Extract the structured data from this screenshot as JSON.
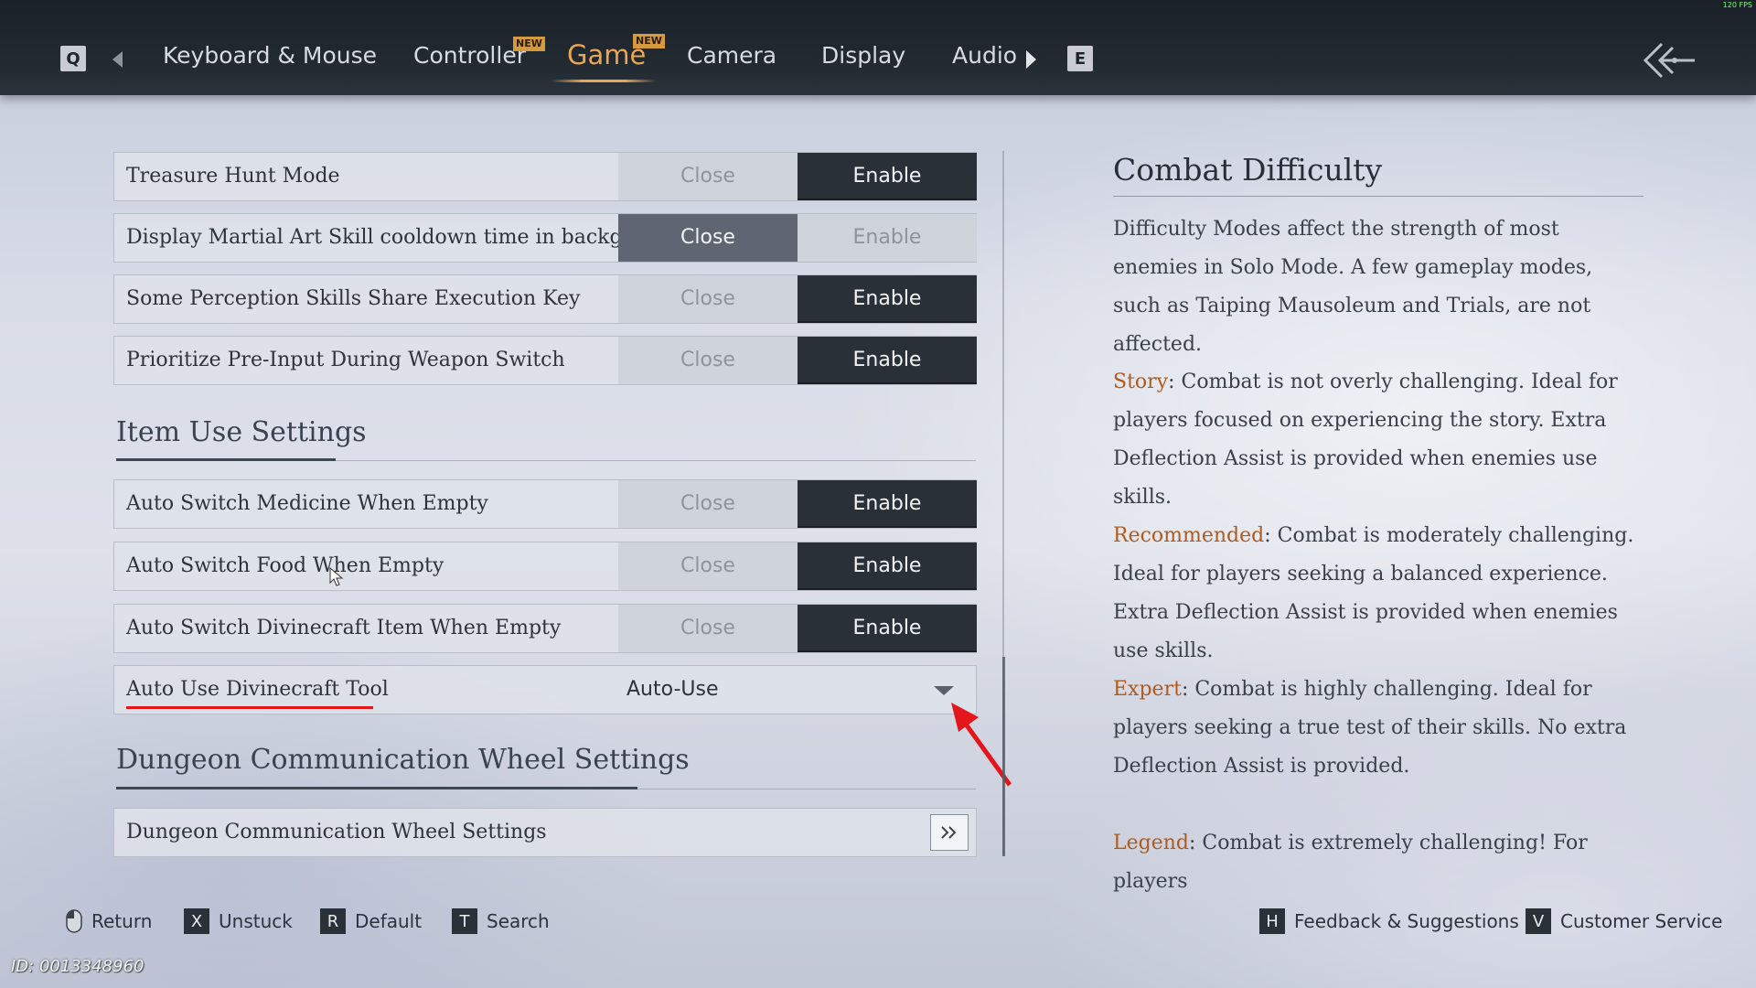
{
  "topbar": {
    "fps": "120 FPS",
    "left_key": "Q",
    "right_key": "E",
    "new_badge": "NEW",
    "tabs": [
      {
        "label": "Keyboard & Mouse"
      },
      {
        "label": "Controller"
      },
      {
        "label": "Game"
      },
      {
        "label": "Camera"
      },
      {
        "label": "Display"
      },
      {
        "label": "Audio"
      }
    ]
  },
  "options": {
    "close": "Close",
    "enable": "Enable"
  },
  "settings": [
    {
      "label": "Treasure Hunt Mode",
      "selected": "Enable"
    },
    {
      "label": "Display Martial Art Skill cooldown time in background",
      "selected": "Close"
    },
    {
      "label": "Some Perception Skills Share Execution Key",
      "selected": "Enable"
    },
    {
      "label": "Prioritize Pre-Input During Weapon Switch",
      "selected": "Enable"
    }
  ],
  "item_use": {
    "title": "Item Use Settings",
    "rows": [
      {
        "label": "Auto Switch Medicine When Empty",
        "selected": "Enable"
      },
      {
        "label": "Auto Switch Food When Empty",
        "selected": "Enable"
      },
      {
        "label": "Auto Switch Divinecraft Item When Empty",
        "selected": "Enable"
      }
    ],
    "dropdown": {
      "label": "Auto Use Divinecraft Tool",
      "value": "Auto-Use"
    }
  },
  "dungeon": {
    "title": "Dungeon Communication Wheel Settings",
    "row_label": "Dungeon Communication Wheel Settings"
  },
  "description": {
    "title": "Combat Difficulty",
    "intro": "Difficulty Modes affect the strength of most enemies in Solo Mode. A few gameplay modes, such as Taiping Mausoleum and Trials, are not affected.",
    "modes": [
      {
        "name": "Story",
        "text": ": Combat is not overly challenging. Ideal for players focused on experiencing the story. Extra Deflection Assist is provided when enemies use skills."
      },
      {
        "name": "Recommended",
        "text": ": Combat is moderately challenging. Ideal for players seeking a balanced experience. Extra Deflection Assist is provided when enemies use skills."
      },
      {
        "name": "Expert",
        "text": ": Combat is highly challenging. Ideal for players seeking a true test of their skills. No extra Deflection Assist is provided."
      },
      {
        "name": "Legend",
        "text": ": Combat is extremely challenging! For players"
      }
    ]
  },
  "bottom": {
    "return": "Return",
    "unstuck_key": "X",
    "unstuck": "Unstuck",
    "default_key": "R",
    "default": "Default",
    "search_key": "T",
    "search": "Search",
    "feedback_key": "H",
    "feedback": "Feedback & Suggestions",
    "service_key": "V",
    "service": "Customer Service"
  },
  "player_id": "ID: 0013348960",
  "colors": {
    "accent": "#e9a653",
    "highlight": "#b15a1d",
    "annotation": "#e3161b"
  }
}
